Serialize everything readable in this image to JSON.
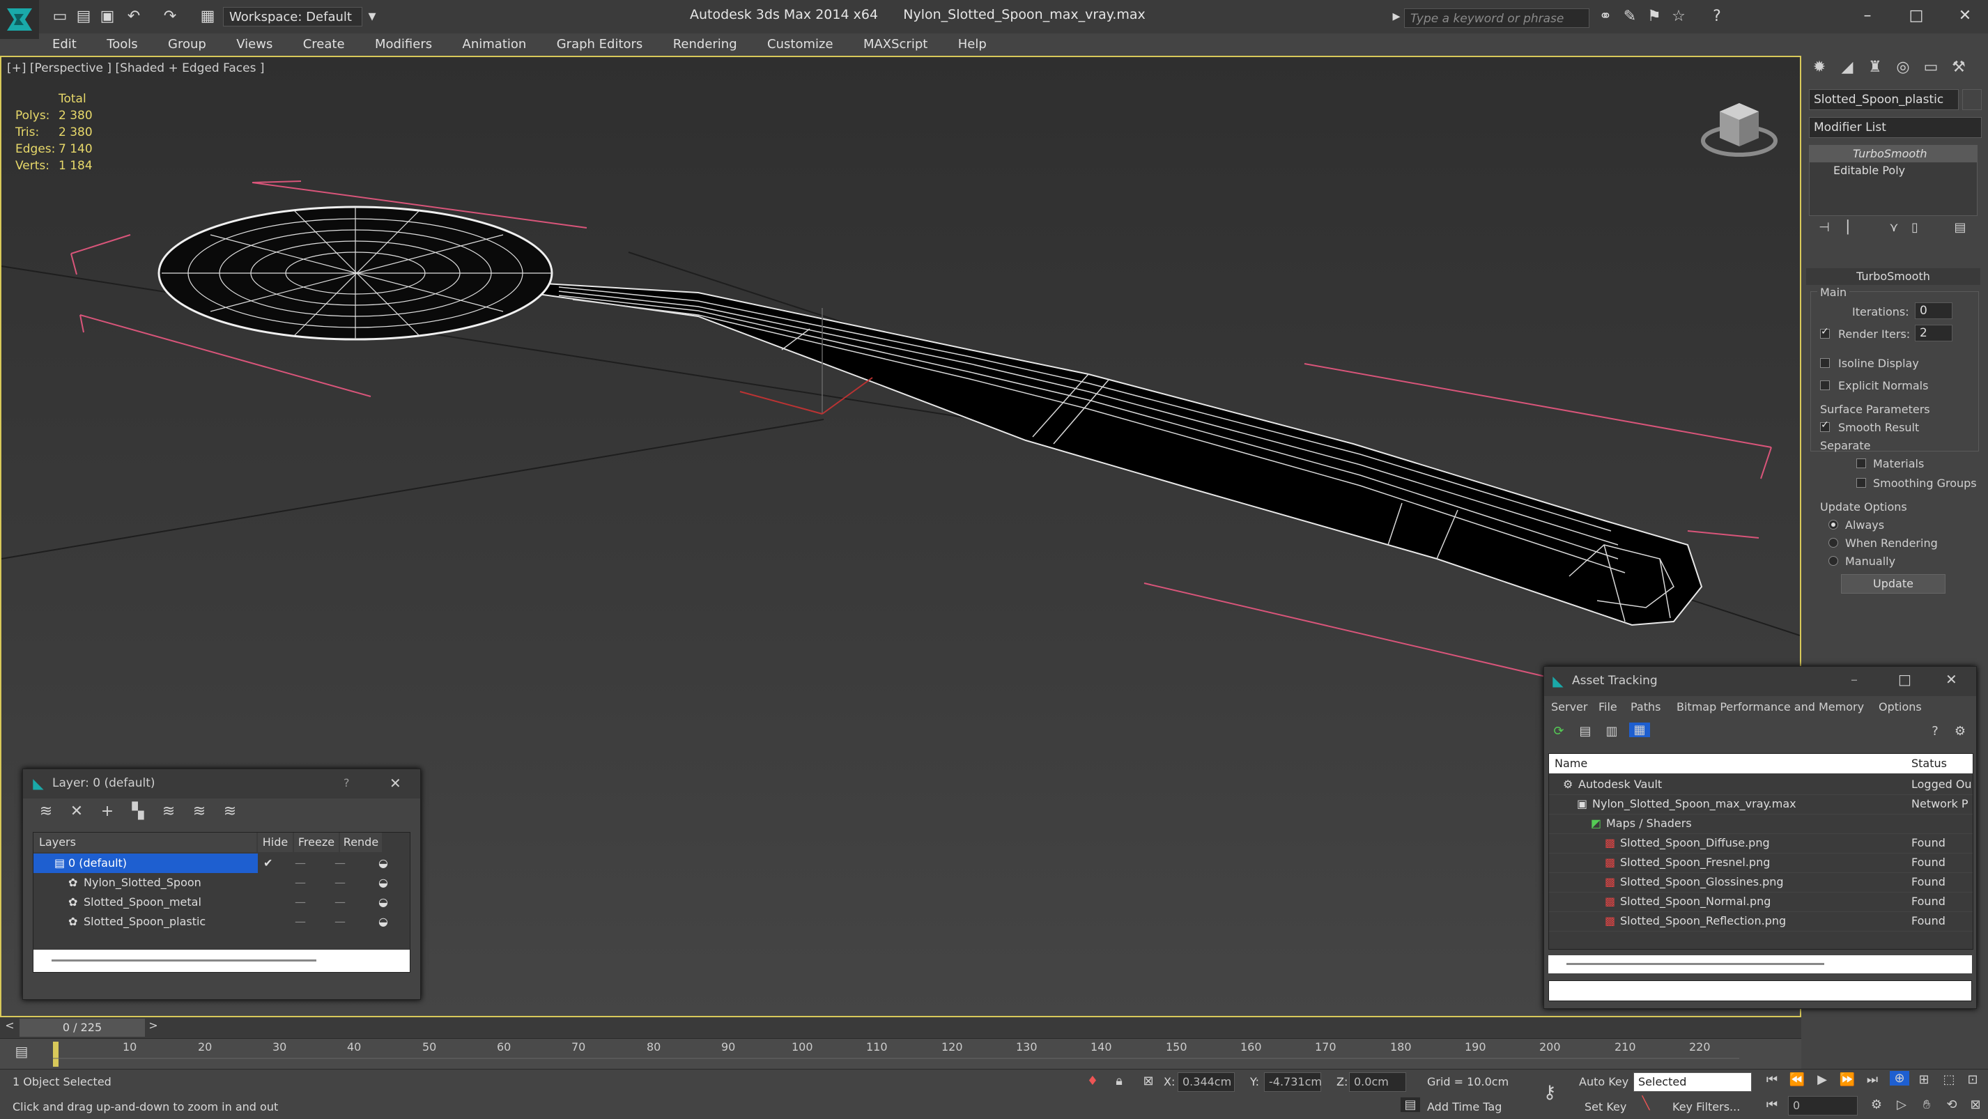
{
  "titlebar": {
    "workspace": "Workspace: Default",
    "app_title": "Autodesk 3ds Max  2014 x64",
    "file_name": "Nylon_Slotted_Spoon_max_vray.max",
    "search_placeholder": "Type a keyword or phrase"
  },
  "menu": [
    "Edit",
    "Tools",
    "Group",
    "Views",
    "Create",
    "Modifiers",
    "Animation",
    "Graph Editors",
    "Rendering",
    "Customize",
    "MAXScript",
    "Help"
  ],
  "viewport": {
    "label": "[+] [Perspective ] [Shaded + Edged Faces ]",
    "stats": {
      "header": "Total",
      "rows": [
        {
          "label": "Polys:",
          "value": "2 380"
        },
        {
          "label": "Tris:",
          "value": "2 380"
        },
        {
          "label": "Edges:",
          "value": "7 140"
        },
        {
          "label": "Verts:",
          "value": "1 184"
        }
      ]
    }
  },
  "command_panel": {
    "object_name": "Slotted_Spoon_plastic",
    "modifier_list": "Modifier List",
    "stack": [
      "TurboSmooth",
      "Editable Poly"
    ],
    "rollout_title": "TurboSmooth",
    "main_label": "Main",
    "iterations_label": "Iterations:",
    "iterations_value": "0",
    "render_iters_label": "Render Iters:",
    "render_iters_value": "2",
    "isoline_label": "Isoline Display",
    "explicit_normals_label": "Explicit Normals",
    "surface_params_label": "Surface Parameters",
    "smooth_result_label": "Smooth Result",
    "separate_label": "Separate",
    "materials_label": "Materials",
    "smoothing_groups_label": "Smoothing Groups",
    "update_options_label": "Update Options",
    "always_label": "Always",
    "when_rendering_label": "When Rendering",
    "manually_label": "Manually",
    "update_button": "Update"
  },
  "layer_dialog": {
    "title": "Layer: 0 (default)",
    "help": "?",
    "columns": {
      "layers": "Layers",
      "hide": "Hide",
      "freeze": "Freeze",
      "render": "Rende"
    },
    "rows": [
      {
        "name": "0 (default)",
        "selected": true
      },
      {
        "name": "Nylon_Slotted_Spoon",
        "selected": false
      },
      {
        "name": "Slotted_Spoon_metal",
        "selected": false
      },
      {
        "name": "Slotted_Spoon_plastic",
        "selected": false
      }
    ]
  },
  "asset_dialog": {
    "title": "Asset Tracking",
    "menu": [
      "Server",
      "File",
      "Paths",
      "Bitmap Performance and Memory",
      "Options"
    ],
    "col_name": "Name",
    "col_status": "Status",
    "rows": [
      {
        "name": "Autodesk Vault",
        "status": "Logged Ou",
        "indent": 0
      },
      {
        "name": "Nylon_Slotted_Spoon_max_vray.max",
        "status": "Network P",
        "indent": 1
      },
      {
        "name": "Maps / Shaders",
        "status": "",
        "indent": 2
      },
      {
        "name": "Slotted_Spoon_Diffuse.png",
        "status": "Found",
        "indent": 3
      },
      {
        "name": "Slotted_Spoon_Fresnel.png",
        "status": "Found",
        "indent": 3
      },
      {
        "name": "Slotted_Spoon_Glossines.png",
        "status": "Found",
        "indent": 3
      },
      {
        "name": "Slotted_Spoon_Normal.png",
        "status": "Found",
        "indent": 3
      },
      {
        "name": "Slotted_Spoon_Reflection.png",
        "status": "Found",
        "indent": 3
      }
    ]
  },
  "timeline": {
    "frame": "0 / 225",
    "ticks": [
      "10",
      "20",
      "30",
      "40",
      "50",
      "60",
      "70",
      "80",
      "90",
      "100",
      "110",
      "120",
      "130",
      "140",
      "150",
      "160",
      "170",
      "180",
      "190",
      "200",
      "210",
      "220"
    ]
  },
  "statusbar": {
    "selection": "1 Object Selected",
    "prompt": "Click and drag up-and-down to zoom in and out",
    "x_label": "X:",
    "x_value": "0.344cm",
    "y_label": "Y:",
    "y_value": "-4.731cm",
    "z_label": "Z:",
    "z_value": "0.0cm",
    "grid": "Grid = 10.0cm",
    "add_time_tag": "Add Time Tag",
    "auto_key": "Auto Key",
    "selected_dropdown": "Selected",
    "set_key": "Set Key",
    "key_filters": "Key Filters...",
    "frame_value": "0"
  },
  "colors": {
    "accent_yellow": "#e8d96a",
    "selection_blue": "#1e5fd0",
    "viewport_border": "#d8c95a",
    "gizmo_pink": "#d9557a"
  }
}
